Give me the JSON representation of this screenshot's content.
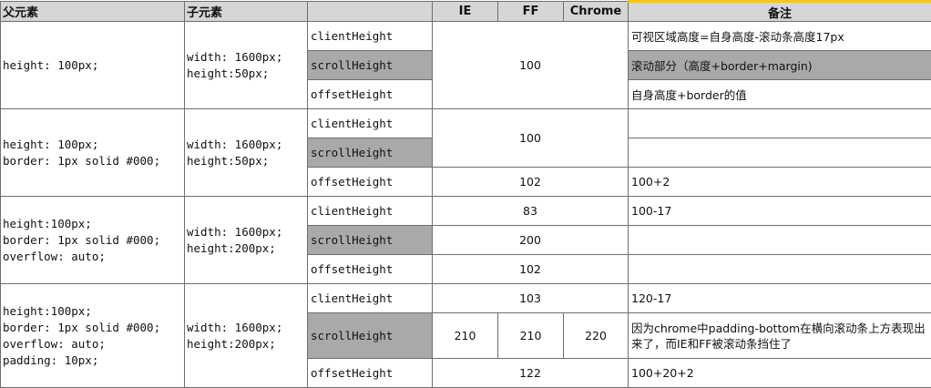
{
  "headers": {
    "parent": "父元素",
    "child": "子元素",
    "prop": "",
    "ie": "IE",
    "ff": "FF",
    "chrome": "Chrome",
    "note": "备注"
  },
  "groups": [
    {
      "parent_css": "height: 100px;",
      "child_css": "width: 1600px;\nheight:50px;",
      "rows": [
        {
          "prop": "clientHeight",
          "value": "100",
          "note": "可视区域高度=自身高度-滚动条高度17px"
        },
        {
          "prop": "scrollHeight",
          "note": "滚动部分（高度+border+margin)"
        },
        {
          "prop": "offsetHeight",
          "note": "自身高度+border的值"
        }
      ]
    },
    {
      "parent_css": "height: 100px;\nborder: 1px solid #000;",
      "child_css": "width: 1600px;\nheight:50px;",
      "rows": [
        {
          "prop": "clientHeight",
          "value": "100",
          "note": ""
        },
        {
          "prop": "scrollHeight",
          "note": ""
        },
        {
          "prop": "offsetHeight",
          "value": "102",
          "note": "100+2"
        }
      ]
    },
    {
      "parent_css": "height:100px;\nborder: 1px solid #000;\noverflow: auto;",
      "child_css": "width: 1600px;\nheight:200px;",
      "rows": [
        {
          "prop": "clientHeight",
          "value": "83",
          "note": "100-17"
        },
        {
          "prop": "scrollHeight",
          "value": "200",
          "note": ""
        },
        {
          "prop": "offsetHeight",
          "value": "102",
          "note": ""
        }
      ]
    },
    {
      "parent_css": "height:100px;\nborder: 1px solid #000;\noverflow: auto;\npadding: 10px;",
      "child_css": "width: 1600px;\nheight:200px;",
      "rows": [
        {
          "prop": "clientHeight",
          "value": "103",
          "note": "120-17"
        },
        {
          "prop": "scrollHeight",
          "ie": "210",
          "ff": "210",
          "chrome": "220",
          "note": "因为chrome中padding-bottom在横向滚动条上方表现出来了，而IE和FF被滚动条挡住了"
        },
        {
          "prop": "offsetHeight",
          "value": "122",
          "note": "100+20+2"
        }
      ]
    }
  ]
}
